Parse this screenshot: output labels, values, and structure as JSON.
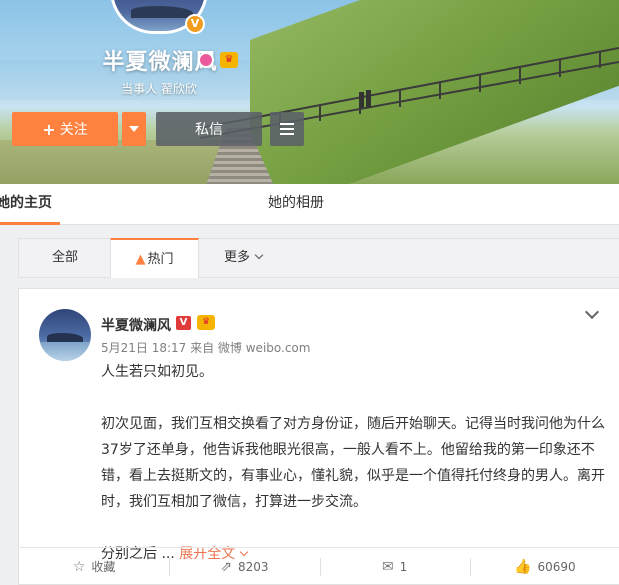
{
  "profile": {
    "name": "半夏微澜风",
    "subtitle": "当事人 翟欣欣",
    "verified_badge": "V",
    "crown_badge": "♛"
  },
  "actions": {
    "follow_plus": "+",
    "follow_label": "关注",
    "message_label": "私信"
  },
  "tabs": {
    "home": "她的主页",
    "album": "她的相册"
  },
  "filters": {
    "all": "全部",
    "hot_icon": "▲",
    "hot": "热门",
    "more": "更多"
  },
  "post": {
    "author": "半夏微澜风",
    "v_badge": "V",
    "crown": "♛",
    "meta": "5月21日 18:17 来自 微博 weibo.com",
    "line1": "人生若只如初见。",
    "para": "初次见面，我们互相交换看了对方身份证，随后开始聊天。记得当时我问他为什么37岁了还单身，他告诉我他眼光很高，一般人看不上。他留给我的第一印象还不错，看上去挺斯文的，有事业心，懂礼貌，似乎是一个值得托付终身的男人。离开时，我们互相加了微信，打算进一步交流。",
    "tail": "分别之后 ...",
    "expand": "展开全文"
  },
  "footer": {
    "fav_icon": "☆",
    "fav": "收藏",
    "share_icon": "⇗",
    "share": "8203",
    "comment_icon": "✉",
    "comment": "1",
    "like_icon": "👍",
    "like": "60690"
  },
  "colors": {
    "accent": "#ff8140",
    "link": "#eb7350"
  }
}
